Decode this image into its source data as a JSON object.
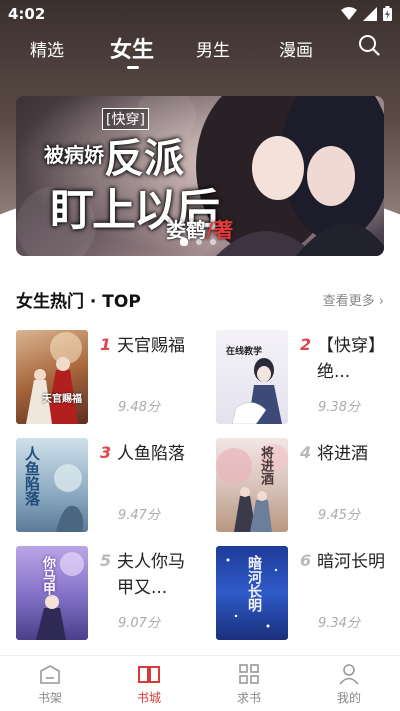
{
  "status_bar": {
    "time": "4:02"
  },
  "top_tabs": [
    {
      "label": "精选"
    },
    {
      "label": "女生"
    },
    {
      "label": "男生"
    },
    {
      "label": "漫画"
    }
  ],
  "banner": {
    "tag": "[快穿]",
    "line1_small": "被病娇",
    "line1_big": "反派",
    "line2": "盯上以后",
    "author": "娄鹤",
    "author_suffix": "/著"
  },
  "section": {
    "title": "女生热门 · TOP",
    "see_more": "查看更多"
  },
  "books": [
    {
      "rank": "1",
      "title": "天官赐福",
      "score": "9.48分",
      "cover_text": "天官赐福"
    },
    {
      "rank": "2",
      "title": "【快穿】绝...",
      "score": "9.38分",
      "cover_text": "在线教学"
    },
    {
      "rank": "3",
      "title": "人鱼陷落",
      "score": "9.47分",
      "cover_text": "人鱼陷落"
    },
    {
      "rank": "4",
      "title": "将进酒",
      "score": "9.45分",
      "cover_text": "将进酒"
    },
    {
      "rank": "5",
      "title": "夫人你马甲又...",
      "score": "9.07分",
      "cover_text": "你马甲"
    },
    {
      "rank": "6",
      "title": "暗河长明",
      "score": "9.34分",
      "cover_text": "暗河长明"
    }
  ],
  "colors": {
    "rank_top": "#e0474c",
    "rank_other": "#b9b9b9",
    "accent": "#d83a3a"
  },
  "bottom_nav": [
    {
      "label": "书架",
      "icon": "bookshelf-icon"
    },
    {
      "label": "书城",
      "icon": "open-book-icon"
    },
    {
      "label": "求书",
      "icon": "grid-icon"
    },
    {
      "label": "我的",
      "icon": "person-icon"
    }
  ]
}
